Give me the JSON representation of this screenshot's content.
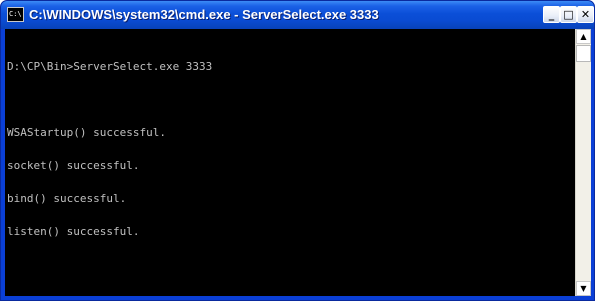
{
  "window": {
    "title": "C:\\WINDOWS\\system32\\cmd.exe - ServerSelect.exe 3333",
    "icon_label": "C:\\",
    "controls": {
      "minimize": "_",
      "maximize": "□",
      "close": "✕"
    }
  },
  "console": {
    "lines": [
      "D:\\CP\\Bin>ServerSelect.exe 3333",
      "",
      "WSAStartup() successful.",
      "socket() successful.",
      "bind() successful.",
      "listen() successful."
    ]
  },
  "scrollbar": {
    "up_arrow": "▲",
    "down_arrow": "▼"
  },
  "colors": {
    "titlebar": "#0a4bd2",
    "console_bg": "#000000",
    "console_fg": "#c0c0c0"
  }
}
